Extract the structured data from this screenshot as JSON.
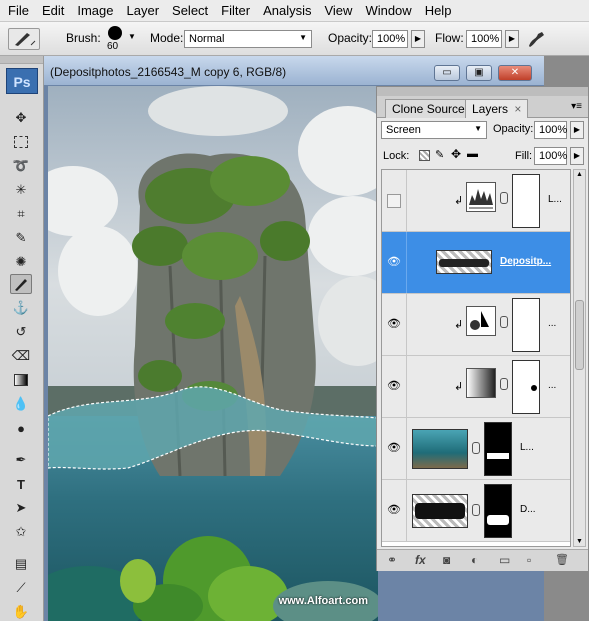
{
  "menu": [
    "File",
    "Edit",
    "Image",
    "Layer",
    "Select",
    "Filter",
    "Analysis",
    "View",
    "Window",
    "Help"
  ],
  "options": {
    "brush_label": "Brush:",
    "brush_size": "60",
    "mode_label": "Mode:",
    "mode_value": "Normal",
    "opacity_label": "Opacity:",
    "opacity_value": "100%",
    "flow_label": "Flow:",
    "flow_value": "100%"
  },
  "toolbar": {
    "logo": "Ps"
  },
  "document": {
    "title": "(Depositphotos_2166543_M copy 6, RGB/8)",
    "min_label": "▭",
    "max_label": "▣",
    "close_label": "✕",
    "watermark": "www.Alfoart.com"
  },
  "layers_panel": {
    "tab_clone": "Clone Source",
    "tab_layers": "Layers",
    "tab_close": "×",
    "blend_mode": "Screen",
    "opacity_label": "Opacity:",
    "opacity_value": "100%",
    "lock_label": "Lock:",
    "fill_label": "Fill:",
    "fill_value": "100%",
    "layers": [
      {
        "name": "L...",
        "visible": false,
        "type": "levels"
      },
      {
        "name": "Depositp...",
        "visible": true,
        "type": "image-selected"
      },
      {
        "name": "...",
        "visible": true,
        "type": "curves"
      },
      {
        "name": "...",
        "visible": true,
        "type": "levels"
      },
      {
        "name": "L...",
        "visible": true,
        "type": "image"
      },
      {
        "name": "D...",
        "visible": true,
        "type": "image"
      }
    ],
    "footer": [
      "⚭",
      "fx",
      "◙",
      "◐",
      "▭",
      "▫",
      "🗑"
    ]
  }
}
